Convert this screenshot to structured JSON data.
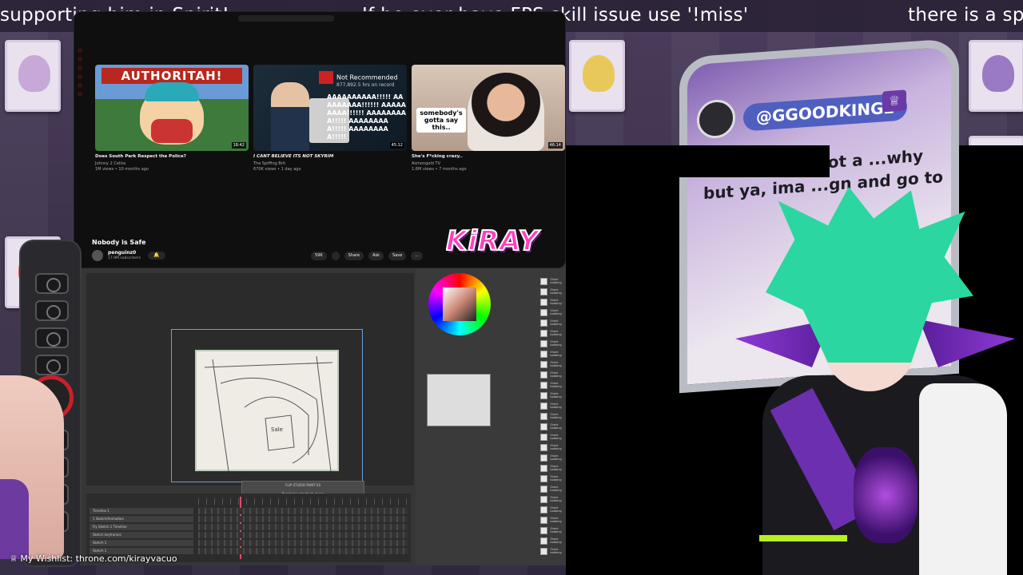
{
  "ticker": {
    "segments": [
      "supporting him in Spirit!",
      "If he ever have FPS skill issue use '!miss'",
      "there is a sp"
    ]
  },
  "youtube": {
    "videos": [
      {
        "thumb_text": "AUTHORITAH!",
        "duration": "18:42",
        "title": "Does South Park Respect the Police?",
        "channel": "Johnny 2 Cellos",
        "meta": "1M views • 10 months ago"
      },
      {
        "thumb_badge": "Not Recommended",
        "thumb_badge_sub": "877,892.5 hrs on record",
        "thumb_scream": "AAAAAAAAAA!!!!! AAAAAAAAA!!!!!! AAAAAAAAA!!!!!! AAAAAAAAA!!!!! AAAAAAAAA!!!!! AAAAAAAAA!!!!!",
        "duration": "45:12",
        "title": "I CANT BELIEVE ITS NOT SKYRIM",
        "channel": "The Spiffing Brit",
        "meta": "670K views • 1 day ago"
      },
      {
        "thumb_caption": "somebody's gotta say this..",
        "duration": "46:14",
        "title": "She's F*cking crazy..",
        "channel": "Asmongold TV",
        "meta": "1.6M views • 7 months ago"
      }
    ],
    "now_playing": {
      "title": "Nobody is Safe",
      "channel": "penguinz0",
      "subscribers": "17.9M subscribers",
      "actions": [
        "59K",
        "",
        "Share",
        "Ask",
        "Save",
        "..."
      ]
    }
  },
  "clip_studio": {
    "dialog_title": "CLIP STUDIO PAINT EX",
    "dialog_message": "Rendering playback range",
    "dialog_progress": 0.18,
    "dialog_button": "Cancel",
    "timeline_tracks": [
      "Timeline 1",
      "1 Sketch/Animation",
      "Fly Sketch 1 Timeline",
      "Sketch keyframes",
      "Sketch 1",
      "Sketch 1"
    ],
    "layer_label": "Shark bobbing"
  },
  "logo": {
    "text": "KiRAY"
  },
  "chat": {
    "username": "@GGOODKING2",
    "crown_icon": "crown-icon",
    "message": "...e reason I got a ...why but ya, ima ...gn and go to"
  },
  "footer": {
    "wishlist": "My Wishlist: throne.com/kirayvacuo"
  },
  "colors": {
    "logo_pink": "#ff3fbf",
    "chat_pill": "#4f5fc0",
    "hair_green": "#2bd6a0",
    "accent_purple": "#6b2fb0"
  }
}
